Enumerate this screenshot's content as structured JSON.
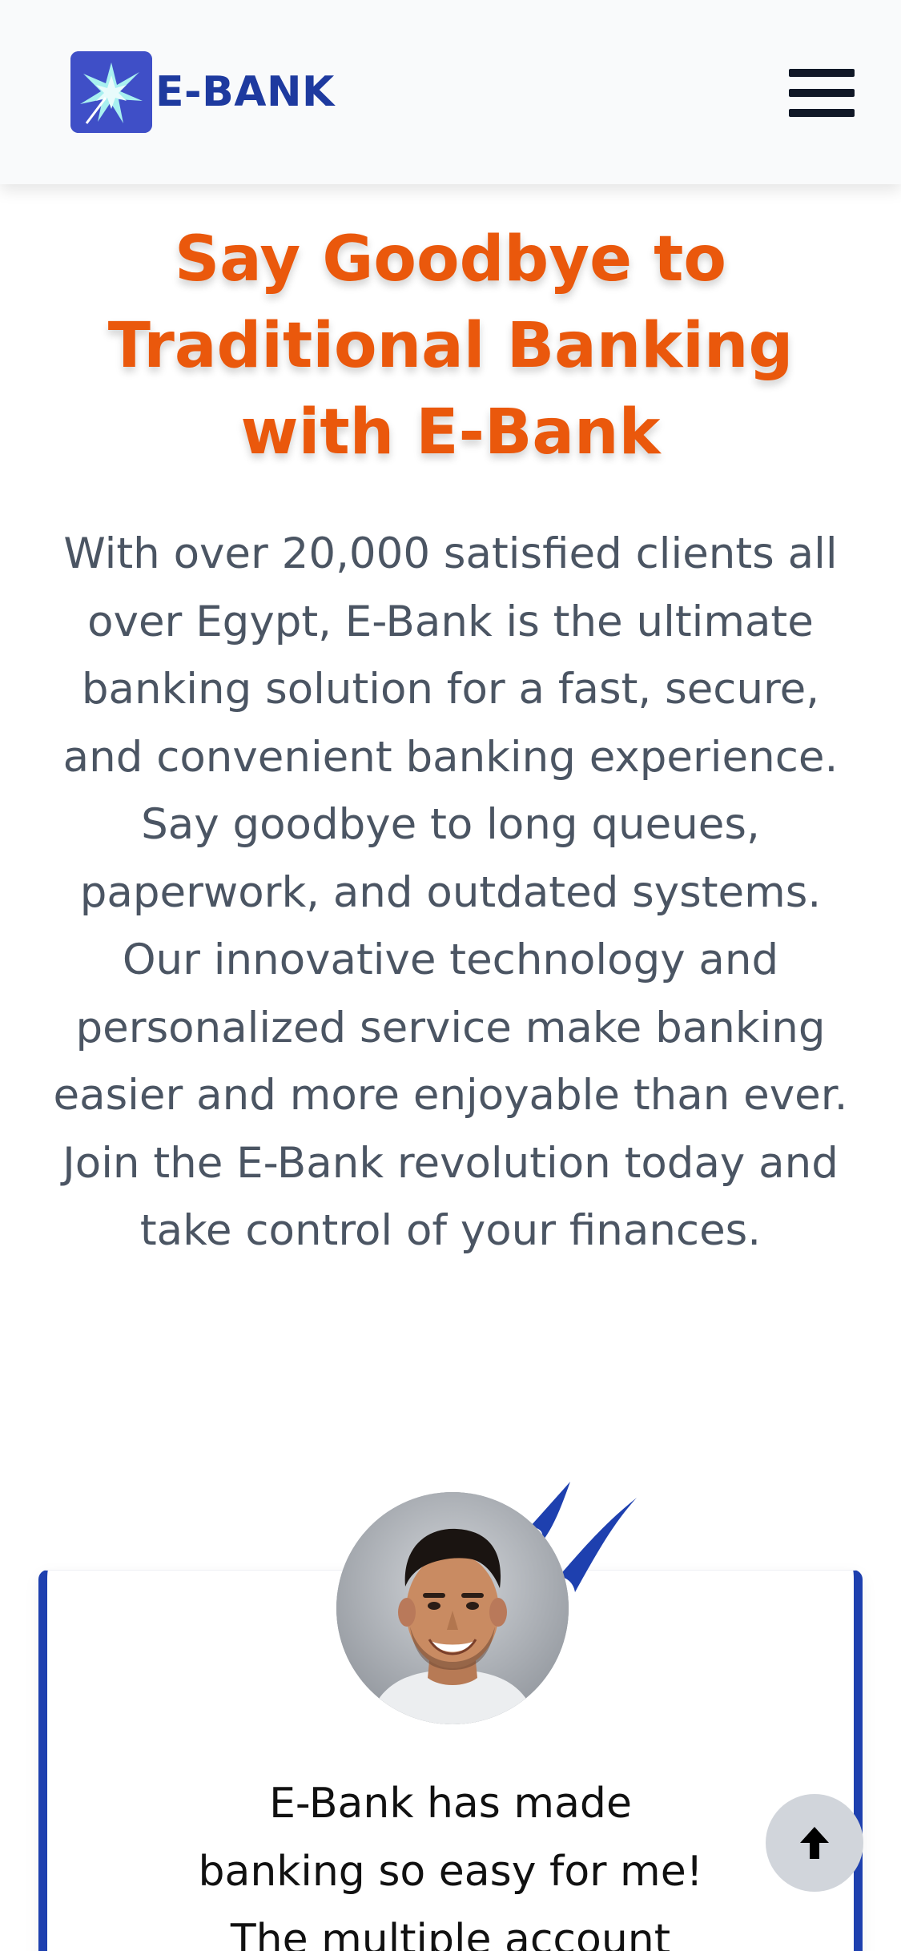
{
  "header": {
    "brand": "E-BANK",
    "logo_icon": "starburst-logo-icon",
    "menu_icon": "hamburger-menu-icon"
  },
  "hero": {
    "title_lines": [
      "Say Goodbye to",
      "Traditional Banking",
      "with E-Bank"
    ],
    "description_lines": [
      "With over 20,000 satisfied clients all",
      "over Egypt, E-Bank is the ultimate",
      "banking solution for a fast, secure,",
      "and convenient banking experience.",
      "Say goodbye to long queues,",
      "paperwork, and outdated systems.",
      "Our innovative technology and",
      "personalized service make banking",
      "easier and more enjoyable than ever.",
      "Join the E-Bank revolution today and",
      "take control of your finances."
    ]
  },
  "testimonial": {
    "quote_icon": "quote-mark-icon",
    "text_lines": [
      "E-Bank has made",
      "banking so easy for me!",
      "The multiple account"
    ]
  },
  "scroll_top": {
    "icon": "arrow-up-icon"
  },
  "colors": {
    "brand_blue": "#1e3a9f",
    "accent_orange": "#ea580c",
    "body_text": "#4b5563",
    "card_border": "#1e40af"
  }
}
